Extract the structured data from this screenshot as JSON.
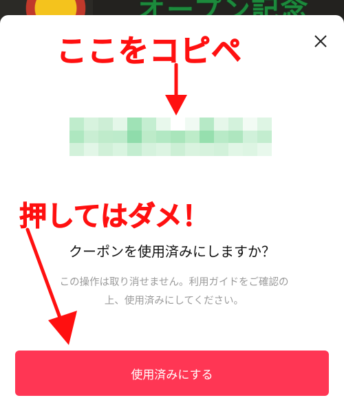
{
  "background_app": {
    "banner_text": "オープン記念"
  },
  "annotations": {
    "copy_here": "ここをコピペ",
    "do_not_press": "押してはダメ！",
    "color": "#ff1010"
  },
  "dialog": {
    "close_icon": "close-icon",
    "coupon_code_state": "pixelated",
    "question": "クーポンを使用済みにしますか？",
    "note_line_1": "この操作は取り消せません。利用ガイドをご確認の",
    "note_line_2": "上、使用済みにしてください。",
    "confirm_button_label": "使用済みにする",
    "accent_color": "#ff3654"
  }
}
